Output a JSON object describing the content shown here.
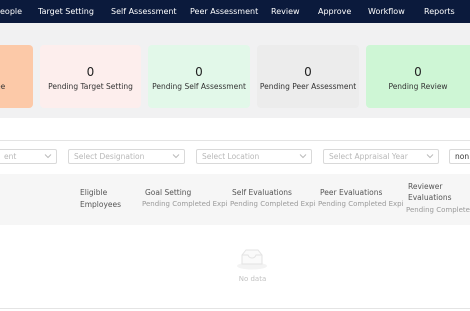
{
  "nav": {
    "items": [
      "eople",
      "Target Setting",
      "Self Assessment",
      "Peer Assessment",
      "Review",
      "Approve",
      "Workflow",
      "Reports"
    ]
  },
  "cards": [
    {
      "value": "",
      "label": "ee",
      "color": "#fcc9a8"
    },
    {
      "value": "0",
      "label": "Pending Target Setting",
      "color": "#fdeeed"
    },
    {
      "value": "0",
      "label": "Pending Self Assessment",
      "color": "#e2f8e9"
    },
    {
      "value": "0",
      "label": "Pending Peer Assessment",
      "color": "#ececec"
    },
    {
      "value": "0",
      "label": "Pending Review",
      "color": "#cef6d5"
    }
  ],
  "filters": {
    "department_placeholder": "ent",
    "designation_placeholder": "Select Designation",
    "location_placeholder": "Select Location",
    "appraisal_year_placeholder": "Select Appraisal Year",
    "extra_value": "non"
  },
  "table": {
    "col_eligible_line1": "Eligible",
    "col_eligible_line2": "Employees",
    "col_goal": "Goal Setting",
    "col_goal_sub": "Pending Completed Expi",
    "col_self": "Self Evaluations",
    "col_self_sub": "Pending Completed Expi",
    "col_peer": "Peer Evaluations",
    "col_peer_sub": "Pending Completed Expi",
    "col_reviewer_line1": "Reviewer",
    "col_reviewer_line2": "Evaluations",
    "col_reviewer_sub": "Pending Complete",
    "empty_text": "No data"
  }
}
